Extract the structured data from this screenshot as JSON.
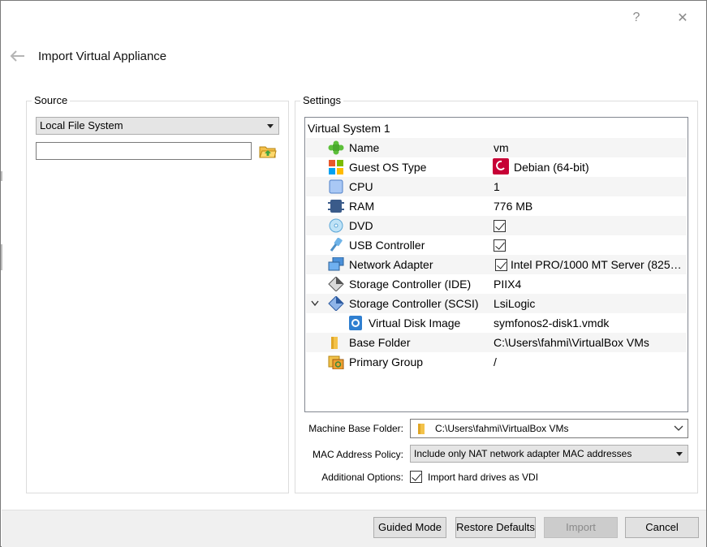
{
  "window": {
    "help_glyph": "?",
    "close_glyph": "✕",
    "title": "Import Virtual Appliance"
  },
  "source": {
    "legend": "Source",
    "combo_value": "Local File System",
    "file_path_value": ""
  },
  "settings": {
    "legend": "Settings",
    "root": "Virtual System 1",
    "rows": [
      {
        "label": "Name",
        "value": "vm",
        "icon": "puzzle-icon"
      },
      {
        "label": "Guest OS Type",
        "value": "Debian (64-bit)",
        "icon": "os-type-icon"
      },
      {
        "label": "CPU",
        "value": "1",
        "icon": "cpu-icon"
      },
      {
        "label": "RAM",
        "value": "776 MB",
        "icon": "ram-icon"
      },
      {
        "label": "DVD",
        "value": "",
        "icon": "dvd-icon"
      },
      {
        "label": "USB Controller",
        "value": "",
        "icon": "usb-icon"
      },
      {
        "label": "Network Adapter",
        "value": "Intel PRO/1000 MT Server (825…",
        "icon": "network-icon"
      },
      {
        "label": "Storage Controller (IDE)",
        "value": "PIIX4",
        "icon": "ide-controller-icon"
      },
      {
        "label": "Storage Controller (SCSI)",
        "value": "LsiLogic",
        "icon": "scsi-controller-icon"
      },
      {
        "label": "Virtual Disk Image",
        "value": "symfonos2-disk1.vmdk",
        "icon": "disk-image-icon"
      },
      {
        "label": "Base Folder",
        "value": "C:\\Users\\fahmi\\VirtualBox VMs",
        "icon": "folder-icon"
      },
      {
        "label": "Primary Group",
        "value": "/",
        "icon": "group-icon"
      }
    ]
  },
  "form": {
    "machine_base_folder_label": "Machine Base Folder:",
    "machine_base_folder_value": "C:\\Users\\fahmi\\VirtualBox VMs",
    "mac_policy_label": "MAC Address Policy:",
    "mac_policy_value": "Include only NAT network adapter MAC addresses",
    "additional_options_label": "Additional Options:",
    "import_vdi_label": "Import hard drives as VDI"
  },
  "buttons": {
    "guided_mode": "Guided Mode",
    "restore_defaults": "Restore Defaults",
    "import": "Import",
    "cancel": "Cancel"
  },
  "colors": {
    "selection_alt_row": "#f5f5f5",
    "button_face": "#e1e1e1",
    "disabled_button": "#cccccc"
  }
}
